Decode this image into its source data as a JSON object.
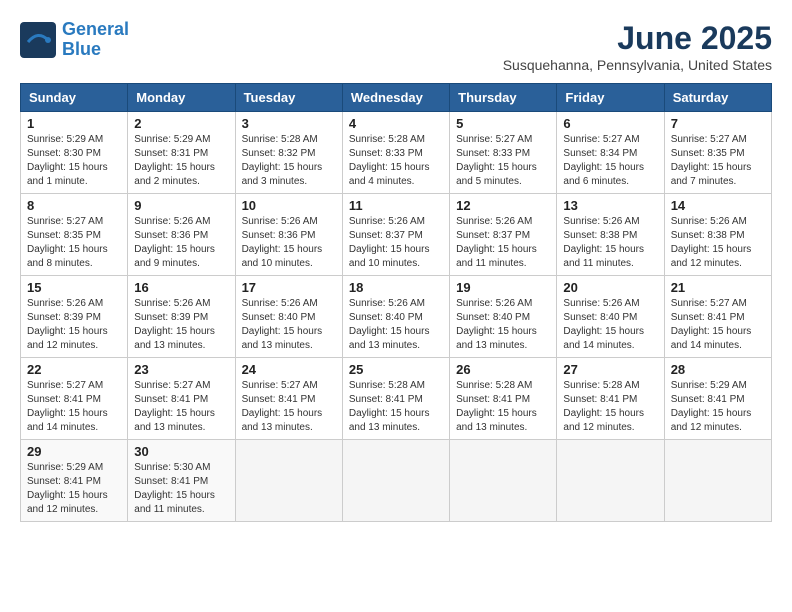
{
  "logo": {
    "line1": "General",
    "line2": "Blue"
  },
  "title": "June 2025",
  "subtitle": "Susquehanna, Pennsylvania, United States",
  "days_of_week": [
    "Sunday",
    "Monday",
    "Tuesday",
    "Wednesday",
    "Thursday",
    "Friday",
    "Saturday"
  ],
  "weeks": [
    [
      {
        "day": "1",
        "info": "Sunrise: 5:29 AM\nSunset: 8:30 PM\nDaylight: 15 hours\nand 1 minute."
      },
      {
        "day": "2",
        "info": "Sunrise: 5:29 AM\nSunset: 8:31 PM\nDaylight: 15 hours\nand 2 minutes."
      },
      {
        "day": "3",
        "info": "Sunrise: 5:28 AM\nSunset: 8:32 PM\nDaylight: 15 hours\nand 3 minutes."
      },
      {
        "day": "4",
        "info": "Sunrise: 5:28 AM\nSunset: 8:33 PM\nDaylight: 15 hours\nand 4 minutes."
      },
      {
        "day": "5",
        "info": "Sunrise: 5:27 AM\nSunset: 8:33 PM\nDaylight: 15 hours\nand 5 minutes."
      },
      {
        "day": "6",
        "info": "Sunrise: 5:27 AM\nSunset: 8:34 PM\nDaylight: 15 hours\nand 6 minutes."
      },
      {
        "day": "7",
        "info": "Sunrise: 5:27 AM\nSunset: 8:35 PM\nDaylight: 15 hours\nand 7 minutes."
      }
    ],
    [
      {
        "day": "8",
        "info": "Sunrise: 5:27 AM\nSunset: 8:35 PM\nDaylight: 15 hours\nand 8 minutes."
      },
      {
        "day": "9",
        "info": "Sunrise: 5:26 AM\nSunset: 8:36 PM\nDaylight: 15 hours\nand 9 minutes."
      },
      {
        "day": "10",
        "info": "Sunrise: 5:26 AM\nSunset: 8:36 PM\nDaylight: 15 hours\nand 10 minutes."
      },
      {
        "day": "11",
        "info": "Sunrise: 5:26 AM\nSunset: 8:37 PM\nDaylight: 15 hours\nand 10 minutes."
      },
      {
        "day": "12",
        "info": "Sunrise: 5:26 AM\nSunset: 8:37 PM\nDaylight: 15 hours\nand 11 minutes."
      },
      {
        "day": "13",
        "info": "Sunrise: 5:26 AM\nSunset: 8:38 PM\nDaylight: 15 hours\nand 11 minutes."
      },
      {
        "day": "14",
        "info": "Sunrise: 5:26 AM\nSunset: 8:38 PM\nDaylight: 15 hours\nand 12 minutes."
      }
    ],
    [
      {
        "day": "15",
        "info": "Sunrise: 5:26 AM\nSunset: 8:39 PM\nDaylight: 15 hours\nand 12 minutes."
      },
      {
        "day": "16",
        "info": "Sunrise: 5:26 AM\nSunset: 8:39 PM\nDaylight: 15 hours\nand 13 minutes."
      },
      {
        "day": "17",
        "info": "Sunrise: 5:26 AM\nSunset: 8:40 PM\nDaylight: 15 hours\nand 13 minutes."
      },
      {
        "day": "18",
        "info": "Sunrise: 5:26 AM\nSunset: 8:40 PM\nDaylight: 15 hours\nand 13 minutes."
      },
      {
        "day": "19",
        "info": "Sunrise: 5:26 AM\nSunset: 8:40 PM\nDaylight: 15 hours\nand 13 minutes."
      },
      {
        "day": "20",
        "info": "Sunrise: 5:26 AM\nSunset: 8:40 PM\nDaylight: 15 hours\nand 14 minutes."
      },
      {
        "day": "21",
        "info": "Sunrise: 5:27 AM\nSunset: 8:41 PM\nDaylight: 15 hours\nand 14 minutes."
      }
    ],
    [
      {
        "day": "22",
        "info": "Sunrise: 5:27 AM\nSunset: 8:41 PM\nDaylight: 15 hours\nand 14 minutes."
      },
      {
        "day": "23",
        "info": "Sunrise: 5:27 AM\nSunset: 8:41 PM\nDaylight: 15 hours\nand 13 minutes."
      },
      {
        "day": "24",
        "info": "Sunrise: 5:27 AM\nSunset: 8:41 PM\nDaylight: 15 hours\nand 13 minutes."
      },
      {
        "day": "25",
        "info": "Sunrise: 5:28 AM\nSunset: 8:41 PM\nDaylight: 15 hours\nand 13 minutes."
      },
      {
        "day": "26",
        "info": "Sunrise: 5:28 AM\nSunset: 8:41 PM\nDaylight: 15 hours\nand 13 minutes."
      },
      {
        "day": "27",
        "info": "Sunrise: 5:28 AM\nSunset: 8:41 PM\nDaylight: 15 hours\nand 12 minutes."
      },
      {
        "day": "28",
        "info": "Sunrise: 5:29 AM\nSunset: 8:41 PM\nDaylight: 15 hours\nand 12 minutes."
      }
    ],
    [
      {
        "day": "29",
        "info": "Sunrise: 5:29 AM\nSunset: 8:41 PM\nDaylight: 15 hours\nand 12 minutes."
      },
      {
        "day": "30",
        "info": "Sunrise: 5:30 AM\nSunset: 8:41 PM\nDaylight: 15 hours\nand 11 minutes."
      },
      {
        "day": "",
        "info": ""
      },
      {
        "day": "",
        "info": ""
      },
      {
        "day": "",
        "info": ""
      },
      {
        "day": "",
        "info": ""
      },
      {
        "day": "",
        "info": ""
      }
    ]
  ]
}
